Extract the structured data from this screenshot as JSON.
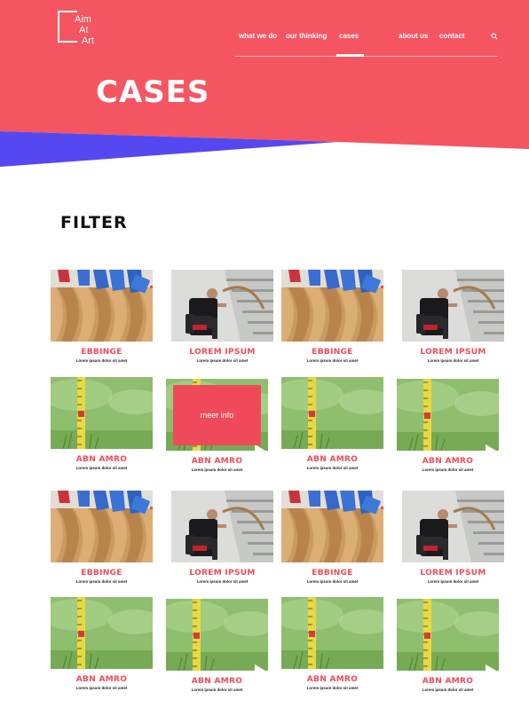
{
  "brand": {
    "logo_lines": [
      "Aim",
      "At",
      "Art"
    ]
  },
  "nav": {
    "items": [
      {
        "label": "what we do"
      },
      {
        "label": "our thinking"
      },
      {
        "label": "cases"
      },
      {
        "label": "about us"
      },
      {
        "label": "contact"
      }
    ],
    "active": "cases",
    "search_icon": "search-icon"
  },
  "page": {
    "title": "CASES"
  },
  "filter": {
    "label": "FILTER"
  },
  "colors": {
    "accent": "#f55561",
    "blue": "#5548f0",
    "title": "#f04a5a"
  },
  "cases": [
    {
      "title": "EBBINGE",
      "subtitle": "Lorem ipsum dolor sit amet",
      "image": "hangers"
    },
    {
      "title": "LOREM IPSUM",
      "subtitle": "Lorem ipsum dolor sit amet",
      "image": "backpack"
    },
    {
      "title": "EBBINGE",
      "subtitle": "Lorem ipsum dolor sit amet",
      "image": "hangers"
    },
    {
      "title": "LOREM IPSUM",
      "subtitle": "Lorem ipsum dolor sit amet",
      "image": "backpack"
    },
    {
      "title": "ABN AMRO",
      "subtitle": "Lorem ipsum dolor sit amet",
      "image": "tape"
    },
    {
      "title": "ABN AMRO",
      "subtitle": "Lorem ipsum dolor sit amet",
      "image": "tape",
      "hover_label": "meer info"
    },
    {
      "title": "ABN AMRO",
      "subtitle": "Lorem ipsum dolor sit amet",
      "image": "tape"
    },
    {
      "title": "ABN AMRO",
      "subtitle": "Lorem ipsum dolor sit amet",
      "image": "tape"
    },
    {
      "title": "EBBINGE",
      "subtitle": "Lorem ipsum dolor sit amet",
      "image": "hangers"
    },
    {
      "title": "LOREM IPSUM",
      "subtitle": "Lorem ipsum dolor sit amet",
      "image": "backpack"
    },
    {
      "title": "EBBINGE",
      "subtitle": "Lorem ipsum dolor sit amet",
      "image": "hangers"
    },
    {
      "title": "LOREM IPSUM",
      "subtitle": "Lorem ipsum dolor sit amet",
      "image": "backpack"
    },
    {
      "title": "ABN AMRO",
      "subtitle": "Lorem ipsum dolor sit amet",
      "image": "tape"
    },
    {
      "title": "ABN AMRO",
      "subtitle": "Lorem ipsum dolor sit amet",
      "image": "tape"
    },
    {
      "title": "ABN AMRO",
      "subtitle": "Lorem ipsum dolor sit amet",
      "image": "tape"
    },
    {
      "title": "ABN AMRO",
      "subtitle": "Lorem ipsum dolor sit amet",
      "image": "tape"
    }
  ]
}
